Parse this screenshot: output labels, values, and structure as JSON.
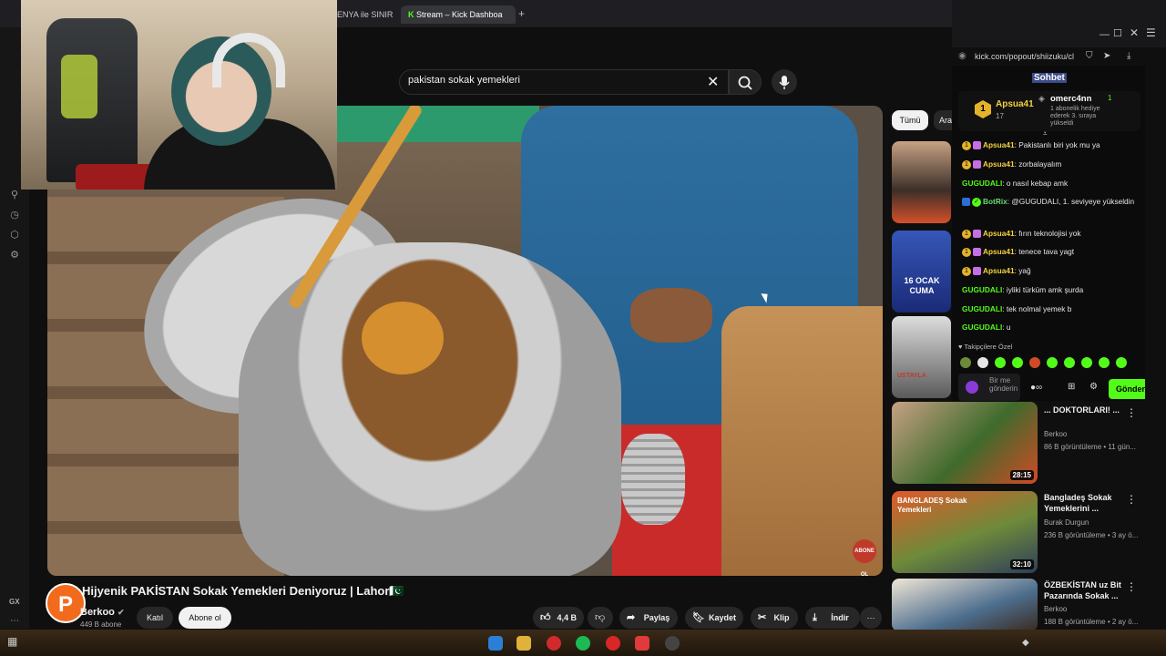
{
  "browser": {
    "tabs": [
      {
        "label": "ENYA ile SINIRS"
      },
      {
        "label": "Stream – Kick Dashboa"
      }
    ],
    "new_tab": "+",
    "sidebar_label": "GX"
  },
  "youtube": {
    "search": {
      "value": "pakistan sokak yemekleri"
    },
    "video": {
      "title": "Hijyenik PAKİSTAN Sokak Yemekleri Deniyoruz | Lahor🇵🇰",
      "watermark": "ABONE OL"
    },
    "channel": {
      "avatar_letter": "P",
      "name": "Berkoo",
      "subs": "449 B abone"
    },
    "actions": {
      "join": "Katıl",
      "subscribe": "Abone ol",
      "likes": "4,4 B",
      "share": "Paylaş",
      "save": "Kaydet",
      "clip": "Klip",
      "download": "İndir"
    },
    "filters": [
      "Tümü",
      "Ara"
    ],
    "recommendations": [
      {
        "thumb_text": "",
        "title": "",
        "channel": "",
        "meta": "",
        "duration": ""
      },
      {
        "thumb_text": "16 OCAK CUMA",
        "title": "",
        "channel": "",
        "meta": "",
        "duration": ""
      },
      {
        "thumb_text": "USTAYLA",
        "title": "",
        "channel": "",
        "meta": "",
        "duration": ""
      },
      {
        "title": "... DOKTORLARI! ...",
        "channel": "Berkoo",
        "meta": "86 B görüntüleme • 11 gün...",
        "duration": "28:15"
      },
      {
        "thumb_text": "BANGLADEŞ Sokak Yemekleri",
        "title": "Bangladeş Sokak Yemeklerini ...",
        "channel": "Burak Durgun",
        "meta": "236 B görüntüleme • 3 ay ö...",
        "duration": "32:10"
      },
      {
        "title": "ÖZBEKİSTAN uz Bit Pazarında Sokak ...",
        "channel": "Berkoo",
        "meta": "188 B görüntüleme • 2 ay ö...",
        "duration": ""
      }
    ]
  },
  "kick": {
    "url": "kick.com/popout/shiizuku/cl",
    "tab": "Sohbet",
    "pinned": {
      "top_user": "Apsua41",
      "top_count": "17",
      "gifter": "omerc4nn",
      "gifter_count": "1",
      "message": "1 abonelik hediye ederek 3. sıraya yükseldi"
    },
    "messages": [
      {
        "user": "Apsua41",
        "text": "Pakistanlı biri yok mu ya",
        "style": "y"
      },
      {
        "user": "Apsua41",
        "text": "zorbalayalım",
        "style": "y"
      },
      {
        "user": "GUGUDALI",
        "text": "o nasıl kebap amk",
        "style": "g"
      },
      {
        "user": "BotRix",
        "text": "@GUGUDALI, 1. seviyeye yükseldin",
        "style": "b"
      },
      {
        "user": "Apsua41",
        "text": "fırın teknolojisi yok",
        "style": "y"
      },
      {
        "user": "Apsua41",
        "text": "tenece tava yagt",
        "style": "y"
      },
      {
        "user": "Apsua41",
        "text": "yağ",
        "style": "y"
      },
      {
        "user": "GUGUDALI",
        "text": "iyliki türküm amk şurda",
        "style": "g"
      },
      {
        "user": "GUGUDALI",
        "text": "tek nolmal yemek b",
        "style": "g"
      },
      {
        "user": "GUGUDALI",
        "text": "u",
        "style": "g"
      }
    ],
    "followers_only": "Takipçilere Özel",
    "input_placeholder": "Bir me gönderin",
    "send": "Gönder"
  },
  "colors": {
    "kick_green": "#53fc18",
    "yt_bg": "#0f0f0f"
  },
  "icons": [
    "search-icon",
    "close-icon",
    "mic-icon",
    "like-icon",
    "dislike-icon",
    "share-icon",
    "bookmark-icon",
    "scissors-icon",
    "download-icon",
    "more-icon",
    "settings-icon",
    "history-icon"
  ]
}
